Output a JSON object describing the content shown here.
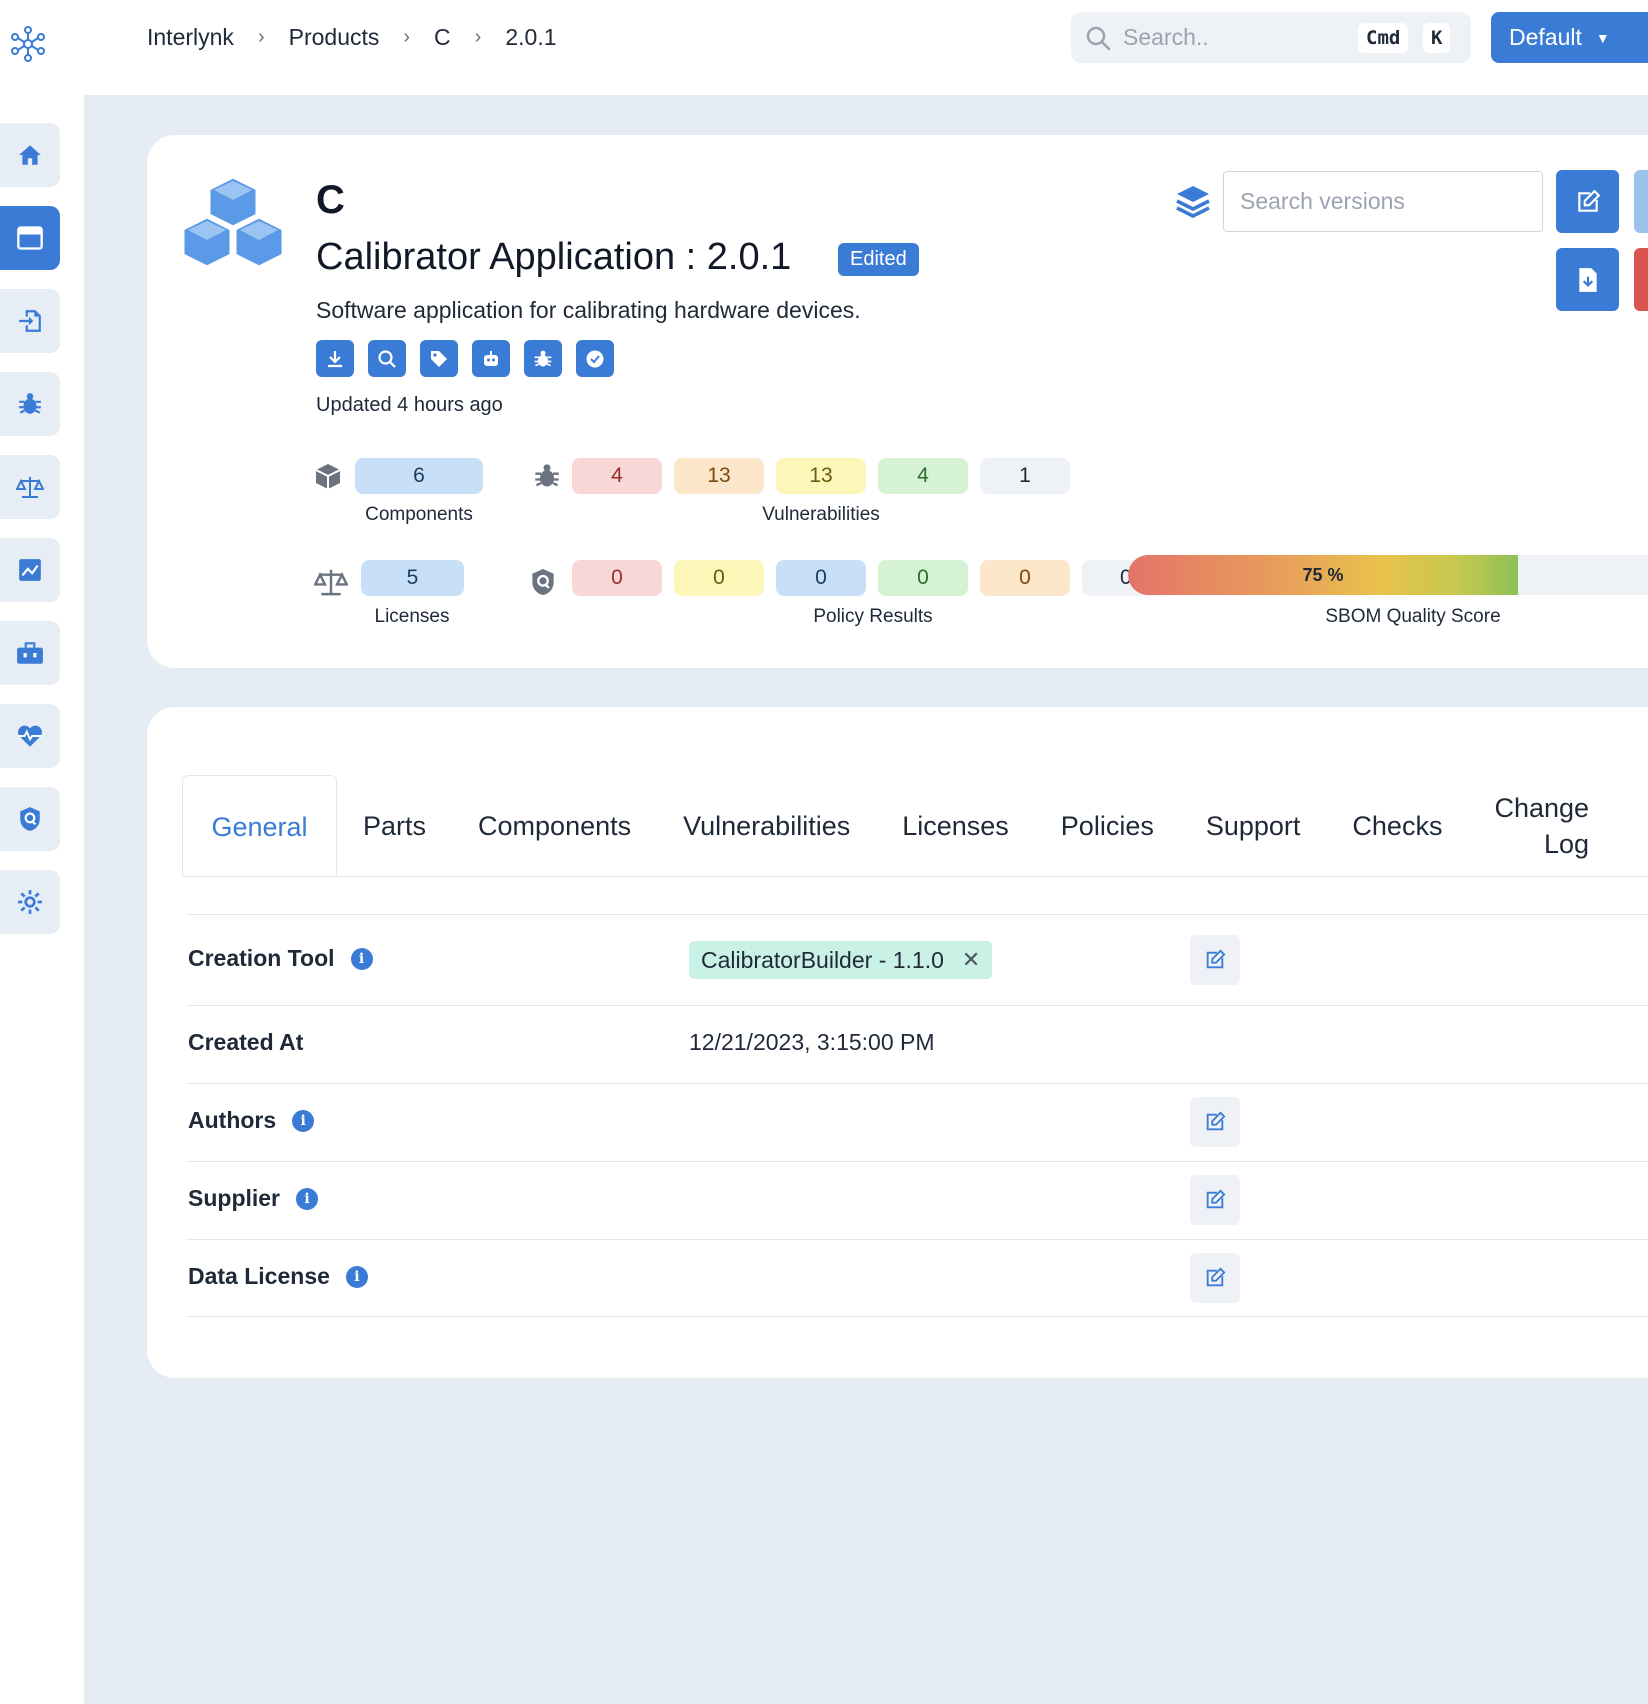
{
  "header": {
    "breadcrumb": [
      "Interlynk",
      "Products",
      "C",
      "2.0.1"
    ],
    "breadcrumb_separator": "›",
    "search": {
      "placeholder": "Search..",
      "shortcut_1": "Cmd",
      "shortcut_2": "K"
    },
    "org_button": "Default"
  },
  "sidebar": {
    "items": [
      {
        "icon": "home-icon"
      },
      {
        "icon": "window-icon",
        "active": true
      },
      {
        "icon": "import-icon"
      },
      {
        "icon": "bug-icon"
      },
      {
        "icon": "scale-icon"
      },
      {
        "icon": "chart-icon"
      },
      {
        "icon": "toolbox-icon"
      },
      {
        "icon": "heart-pulse-icon"
      },
      {
        "icon": "shield-icon"
      },
      {
        "icon": "gear-icon"
      }
    ]
  },
  "product": {
    "name": "C",
    "title": "Calibrator Application : 2.0.1",
    "badge": "Edited",
    "description": "Software application for calibrating hardware devices.",
    "updated": "Updated 4 hours ago",
    "action_icons": [
      "download-icon",
      "search-icon",
      "tag-icon",
      "robot-icon",
      "bug-icon",
      "check-circle-icon"
    ],
    "version_search_placeholder": "Search versions"
  },
  "stats": {
    "components": {
      "value": "6",
      "label": "Components"
    },
    "vulnerabilities": {
      "values": [
        "4",
        "13",
        "13",
        "4",
        "1"
      ],
      "label": "Vulnerabilities"
    },
    "licenses": {
      "value": "5",
      "label": "Licenses"
    },
    "policy_results": {
      "values": [
        "0",
        "0",
        "0",
        "0",
        "0",
        "0"
      ],
      "label": "Policy Results"
    },
    "sbom_quality": {
      "value": "75 %",
      "fraction": 0.75,
      "label": "SBOM Quality Score"
    }
  },
  "colors": {
    "accent": "#3a7bd5",
    "danger": "#d9534f",
    "critical_bg": "#f8d7d7",
    "high_bg": "#fbe6c9",
    "medium_bg": "#fcf6b8",
    "low_bg": "#d6f2d4",
    "info_bg": "#eef1f5",
    "blue_bg": "#c7e0f7"
  },
  "tabs": [
    "General",
    "Parts",
    "Components",
    "Vulnerabilities",
    "Licenses",
    "Policies",
    "Support",
    "Checks",
    "Change Log"
  ],
  "general": {
    "rows": [
      {
        "label": "Creation Tool",
        "info": true,
        "tag": "CalibratorBuilder - 1.1.0",
        "editable": true
      },
      {
        "label": "Created At",
        "info": false,
        "value": "12/21/2023, 3:15:00 PM",
        "editable": false
      },
      {
        "label": "Authors",
        "info": true,
        "editable": true
      },
      {
        "label": "Supplier",
        "info": true,
        "editable": true
      },
      {
        "label": "Data License",
        "info": true,
        "editable": true
      }
    ]
  }
}
